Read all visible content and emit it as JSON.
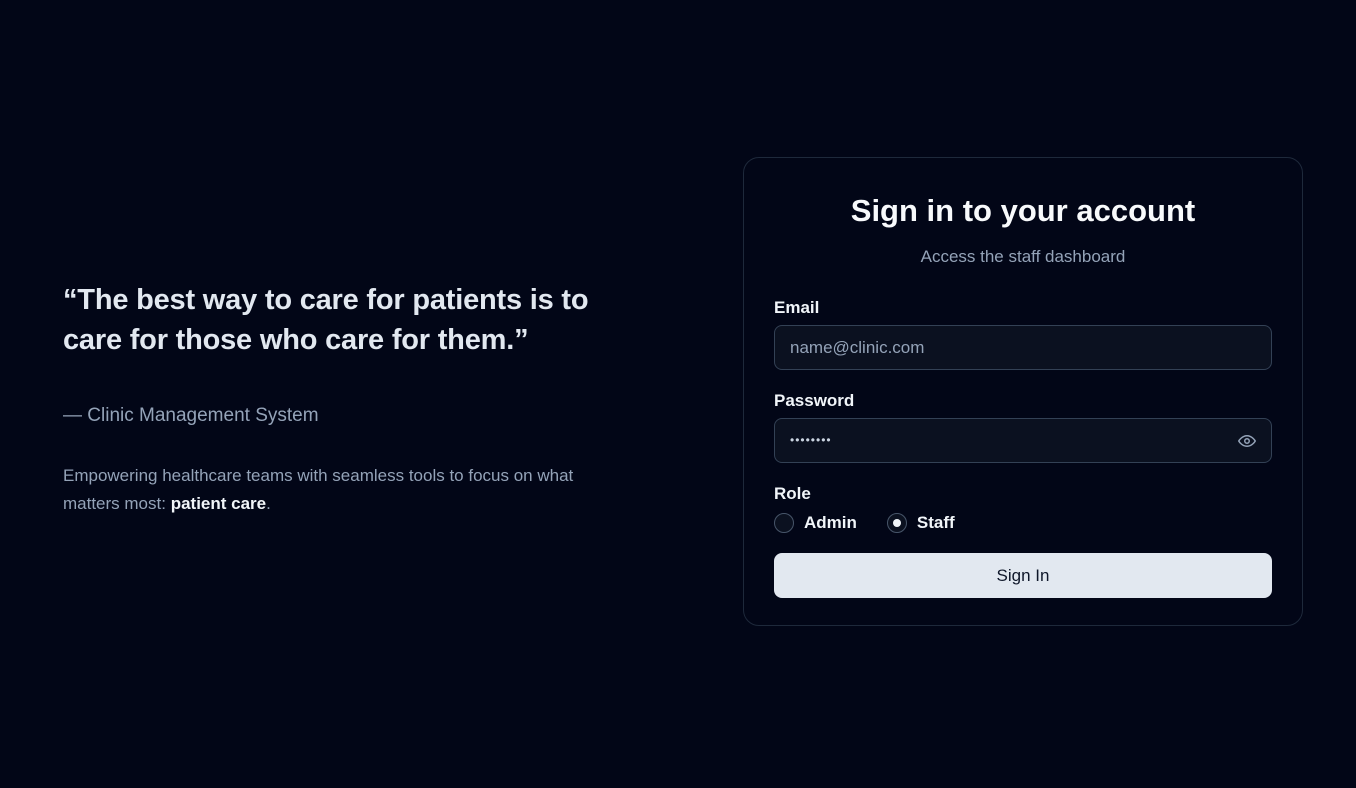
{
  "hero": {
    "quote": "“The best way to care for patients is to care for those who care for them.”",
    "attribution": "— Clinic Management System",
    "tagline_prefix": "Empowering healthcare teams with seamless tools to focus on what matters most: ",
    "tagline_emphasis": "patient care",
    "tagline_suffix": "."
  },
  "card": {
    "title": "Sign in to your account",
    "subtitle": "Access the staff dashboard",
    "email": {
      "label": "Email",
      "placeholder": "name@clinic.com",
      "value": ""
    },
    "password": {
      "label": "Password",
      "masked_value": "••••••••",
      "toggle_icon": "eye-icon"
    },
    "role": {
      "label": "Role",
      "options": [
        {
          "label": "Admin",
          "checked": false
        },
        {
          "label": "Staff",
          "checked": true
        }
      ]
    },
    "submit_label": "Sign In"
  },
  "colors": {
    "background": "#020617",
    "card_border": "#1e293b",
    "button_bg": "#e2e8f0",
    "muted_text": "#94a3b8"
  }
}
